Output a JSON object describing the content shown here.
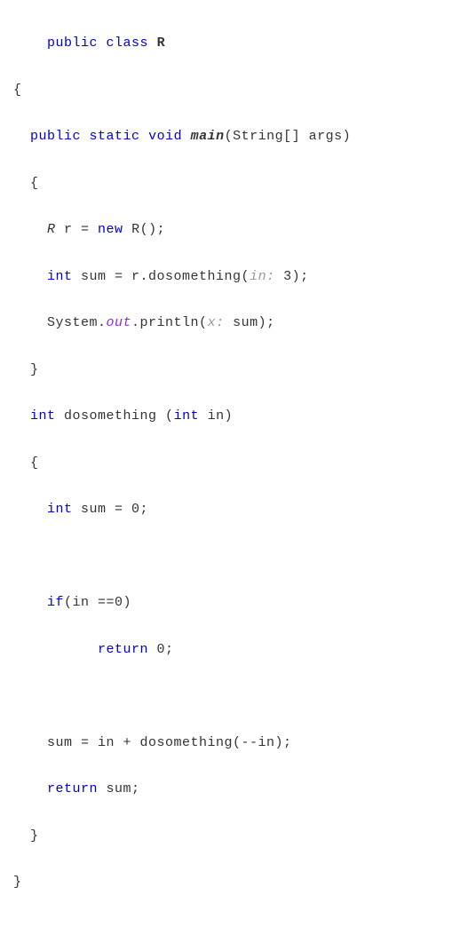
{
  "line1": {
    "kw1": "public",
    "kw2": "class",
    "cls": "R"
  },
  "line2": "{",
  "line3": {
    "kw1": "public",
    "kw2": "static",
    "kw3": "void",
    "name": "main",
    "sig": "(String[] args)"
  },
  "line4": "  {",
  "line5": {
    "type": "R",
    "var": " r = ",
    "kw": "new",
    "rest": " R();"
  },
  "line6": {
    "kw": "int",
    "pre": " sum = r.dosomething(",
    "hint": "in:",
    "val": " 3);"
  },
  "line7": {
    "pre": "System.",
    "out": "out",
    "mid": ".println(",
    "hint": "x:",
    "post": " sum);"
  },
  "line8": "  }",
  "line9": {
    "kw": "int",
    "name": " dosomething (",
    "kw2": "int",
    "rest": " in)"
  },
  "line10": "  {",
  "line11": {
    "kw": "int",
    "rest": " sum = 0;"
  },
  "line12": {
    "kw": "if",
    "rest": "(in ==0)"
  },
  "line13": {
    "kw": "return",
    "rest": " 0;"
  },
  "line14": "    sum = in + dosomething(--in);",
  "line15": {
    "kw": "return",
    "rest": " sum;"
  },
  "line16": "  }",
  "line17": "}"
}
